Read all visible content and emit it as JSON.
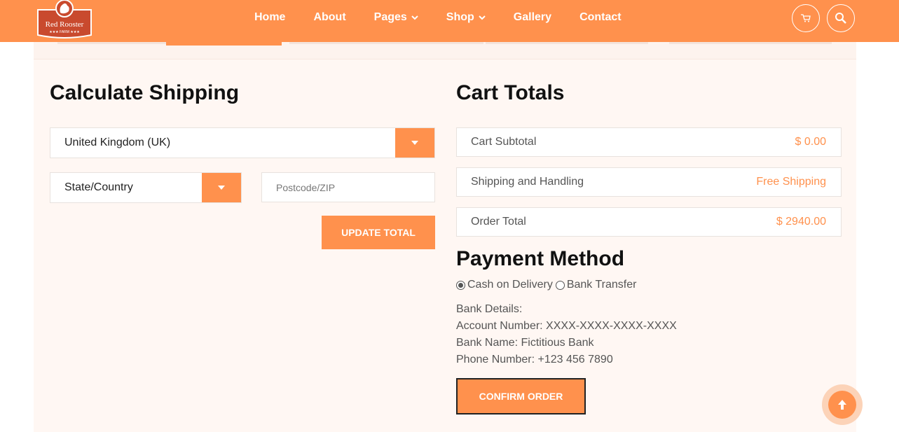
{
  "brand": {
    "logo_text": "Red Rooster",
    "logo_subtext": "FARM"
  },
  "nav": {
    "items": [
      {
        "label": "Home",
        "dropdown": false
      },
      {
        "label": "About",
        "dropdown": false
      },
      {
        "label": "Pages",
        "dropdown": true
      },
      {
        "label": "Shop",
        "dropdown": true
      },
      {
        "label": "Gallery",
        "dropdown": false
      },
      {
        "label": "Contact",
        "dropdown": false
      }
    ],
    "cart_icon": "cart-icon",
    "search_icon": "search-icon"
  },
  "shipping": {
    "title": "Calculate Shipping",
    "country_value": "United Kingdom (UK)",
    "state_value": "State/Country",
    "postcode_placeholder": "Postcode/ZIP",
    "update_button": "UPDATE TOTAL"
  },
  "cart_totals": {
    "title": "Cart Totals",
    "rows": [
      {
        "label": "Cart Subtotal",
        "value": "$ 0.00"
      },
      {
        "label": "Shipping and Handling",
        "value": "Free Shipping"
      },
      {
        "label": "Order Total",
        "value": "$ 2940.00"
      }
    ]
  },
  "payment": {
    "title": "Payment Method",
    "options": [
      {
        "label": "Cash on Delivery",
        "checked": true
      },
      {
        "label": "Bank Transfer",
        "checked": false
      }
    ],
    "bank_details": {
      "heading": "Bank Details:",
      "account": "Account Number: XXXX-XXXX-XXXX-XXXX",
      "bank_name": "Bank Name: Fictitious Bank",
      "phone": "Phone Number: +123 456 7890"
    },
    "confirm_button": "CONFIRM ORDER"
  },
  "colors": {
    "accent": "#ff914d",
    "background": "#fff7f3",
    "heading": "#111111"
  }
}
